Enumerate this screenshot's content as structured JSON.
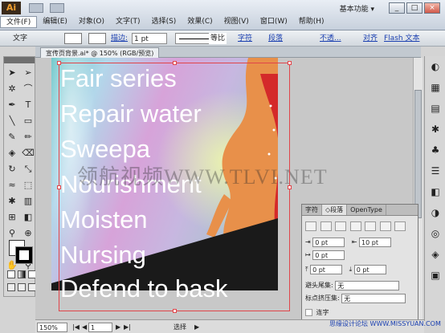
{
  "app": {
    "logo_text": "Ai",
    "workspace_label": "基本功能 ▾"
  },
  "menu": [
    "文件(F)",
    "编辑(E)",
    "对象(O)",
    "文字(T)",
    "选择(S)",
    "效果(C)",
    "视图(V)",
    "窗口(W)",
    "帮助(H)"
  ],
  "window_buttons": [
    "_",
    "□",
    "×"
  ],
  "control_bar": {
    "tool_label": "文字",
    "stroke_link": "描边:",
    "stroke_weight": "1 pt",
    "stroke_profile": "等比",
    "char_link": "字符",
    "para_link": "段落",
    "opacity_link": "不透...",
    "align_link": "对齐",
    "flash_text": "Flash 文本"
  },
  "document": {
    "tab_title": "宣传页背景.ai* @ 150% (RGB/预览)",
    "lines": [
      "Fair series",
      "Repair water",
      "Sweepa",
      "Nourishment",
      "Moisten",
      "Nursing",
      "Defend to bask"
    ],
    "watermark": "领航视频WWW.TLVI.NET"
  },
  "paragraph_panel": {
    "tabs": [
      "字符",
      "◇段落",
      "OpenType"
    ],
    "left_indent": "0 pt",
    "right_indent": "10 pt",
    "first_line_indent": "0 pt",
    "space_before": "0 pt",
    "space_after": "0 pt",
    "hanging_punct_label": "避头尾集:",
    "hanging_punct_value": "无",
    "punct_squeeze_label": "标点挤压集:",
    "punct_squeeze_value": "无",
    "hyphenate_label": "连字"
  },
  "status_bar": {
    "zoom": "150%",
    "page": "1",
    "mode": "选择"
  },
  "site_logo": "思缘设计论坛 WWW.MISSYUAN.COM"
}
